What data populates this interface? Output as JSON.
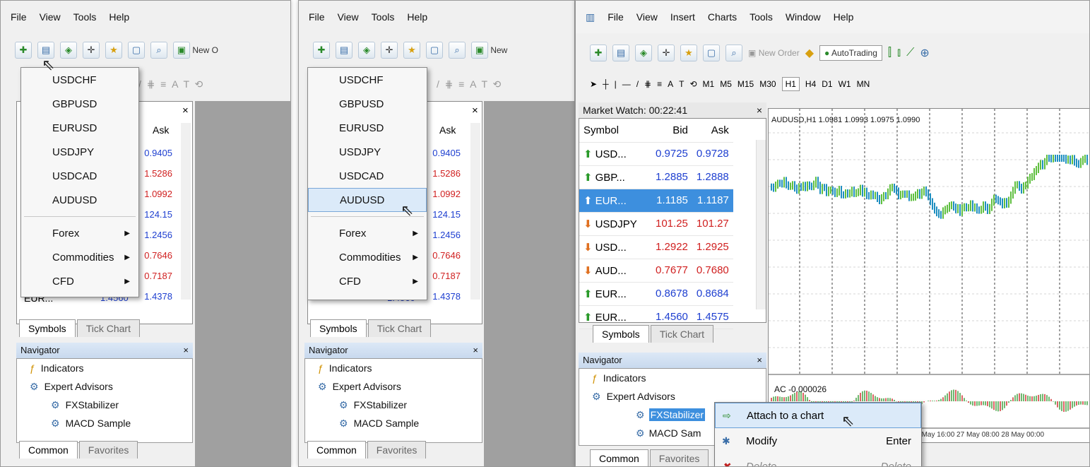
{
  "p1": {
    "menu": [
      "File",
      "View",
      "Tools",
      "Help"
    ],
    "toolbar_new": "New O",
    "close": "×",
    "ask_header": "Ask",
    "ask": [
      {
        "v": "0.9405",
        "c": "up"
      },
      {
        "v": "1.5286",
        "c": "dn"
      },
      {
        "v": "1.0992",
        "c": "dn"
      },
      {
        "v": "124.15",
        "c": "up"
      },
      {
        "v": "1.2456",
        "c": "up"
      },
      {
        "v": "0.7646",
        "c": "dn"
      },
      {
        "v": "0.7187",
        "c": "dn"
      },
      {
        "v": "1.4378",
        "c": "up"
      }
    ],
    "partial_row": "EUR...",
    "partial_bid": "1.4560",
    "tabs": [
      "Symbols",
      "Tick Chart"
    ],
    "dropdown": {
      "symbols": [
        "USDCHF",
        "GBPUSD",
        "EURUSD",
        "USDJPY",
        "USDCAD",
        "AUDUSD"
      ],
      "groups": [
        "Forex",
        "Commodities",
        "CFD"
      ]
    },
    "navigator": {
      "title": "Navigator",
      "items": [
        "Indicators",
        "Expert Advisors",
        "FXStabilizer",
        "MACD Sample"
      ],
      "tabs": [
        "Common",
        "Favorites"
      ]
    }
  },
  "p2": {
    "menu": [
      "File",
      "View",
      "Tools",
      "Help"
    ],
    "toolbar_new": "New",
    "close": "×",
    "ask_header": "Ask",
    "ask": [
      {
        "v": "0.9405",
        "c": "up"
      },
      {
        "v": "1.5286",
        "c": "dn"
      },
      {
        "v": "1.0992",
        "c": "dn"
      },
      {
        "v": "124.15",
        "c": "up"
      },
      {
        "v": "1.2456",
        "c": "up"
      },
      {
        "v": "0.7646",
        "c": "dn"
      },
      {
        "v": "0.7187",
        "c": "dn"
      },
      {
        "v": "1.4378",
        "c": "up"
      }
    ],
    "partial_bid": "1.4560",
    "tabs": [
      "Symbols",
      "Tick Chart"
    ],
    "dropdown": {
      "symbols": [
        "USDCHF",
        "GBPUSD",
        "EURUSD",
        "USDJPY",
        "USDCAD",
        "AUDUSD"
      ],
      "highlighted": "AUDUSD",
      "groups": [
        "Forex",
        "Commodities",
        "CFD"
      ]
    },
    "navigator": {
      "title": "Navigator",
      "items": [
        "Indicators",
        "Expert Advisors",
        "FXStabilizer",
        "MACD Sample"
      ],
      "tabs": [
        "Common",
        "Favorites"
      ]
    }
  },
  "p3": {
    "menu": [
      "File",
      "View",
      "Insert",
      "Charts",
      "Tools",
      "Window",
      "Help"
    ],
    "toolbar": {
      "new_order": "New Order",
      "autotrading": "AutoTrading",
      "timeframes": [
        "M1",
        "M5",
        "M15",
        "M30",
        "H1",
        "H4",
        "D1",
        "W1",
        "MN"
      ]
    },
    "market_watch": {
      "title": "Market Watch: 00:22:41",
      "headers": [
        "Symbol",
        "Bid",
        "Ask"
      ],
      "rows": [
        {
          "sym": "USD...",
          "bid": "0.9725",
          "ask": "0.9728",
          "dir": "up"
        },
        {
          "sym": "GBP...",
          "bid": "1.2885",
          "ask": "1.2888",
          "dir": "up"
        },
        {
          "sym": "EUR...",
          "bid": "1.1185",
          "ask": "1.1187",
          "dir": "up",
          "sel": true
        },
        {
          "sym": "USDJPY",
          "bid": "101.25",
          "ask": "101.27",
          "dir": "down"
        },
        {
          "sym": "USD...",
          "bid": "1.2922",
          "ask": "1.2925",
          "dir": "down"
        },
        {
          "sym": "AUD...",
          "bid": "0.7677",
          "ask": "0.7680",
          "dir": "down"
        },
        {
          "sym": "EUR...",
          "bid": "0.8678",
          "ask": "0.8684",
          "dir": "up"
        },
        {
          "sym": "EUR...",
          "bid": "1.4560",
          "ask": "1.4575",
          "dir": "up"
        }
      ],
      "tabs": [
        "Symbols",
        "Tick Chart"
      ]
    },
    "chart": {
      "title": "AUDUSD,H1  1.0981 1.0993 1.0975 1.0990",
      "indicator": "AC -0.000026",
      "xaxis": ":00  26 May 16:00  27 May 08:00  28 May 00:00"
    },
    "navigator": {
      "title": "Navigator",
      "items": [
        "Indicators",
        "Expert Advisors",
        "FXStabilizer",
        "MACD Sam"
      ],
      "tabs": [
        "Common",
        "Favorites"
      ]
    },
    "context_menu": {
      "items": [
        {
          "label": "Attach to a chart",
          "shortcut": "",
          "hl": true
        },
        {
          "label": "Modify",
          "shortcut": "Enter"
        },
        {
          "label": "Delete",
          "shortcut": "Delete"
        }
      ]
    }
  }
}
